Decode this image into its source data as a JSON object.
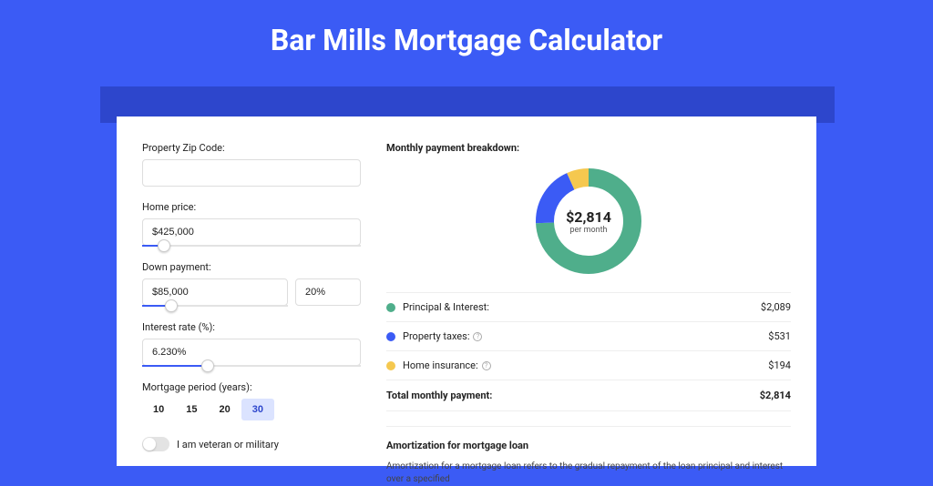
{
  "page_title": "Bar Mills Mortgage Calculator",
  "form": {
    "zip_label": "Property Zip Code:",
    "zip_value": "",
    "home_price_label": "Home price:",
    "home_price_value": "$425,000",
    "home_price_slider_pct": 10,
    "down_label": "Down payment:",
    "down_value": "$85,000",
    "down_pct_value": "20%",
    "down_slider_pct": 20,
    "rate_label": "Interest rate (%):",
    "rate_value": "6.230%",
    "rate_slider_pct": 30,
    "period_label": "Mortgage period (years):",
    "periods": [
      "10",
      "15",
      "20",
      "30"
    ],
    "period_active_index": 3,
    "veteran_label": "I am veteran or military"
  },
  "breakdown": {
    "title": "Monthly payment breakdown:",
    "total_amount": "$2,814",
    "total_sub": "per month",
    "rows": [
      {
        "label": "Principal & Interest:",
        "value": "$2,089",
        "color": "green"
      },
      {
        "label": "Property taxes:",
        "value": "$531",
        "color": "blue",
        "info": true
      },
      {
        "label": "Home insurance:",
        "value": "$194",
        "color": "yellow",
        "info": true
      }
    ],
    "total_label": "Total monthly payment:",
    "total_value": "$2,814"
  },
  "amort": {
    "title": "Amortization for mortgage loan",
    "text": "Amortization for a mortgage loan refers to the gradual repayment of the loan principal and interest over a specified"
  },
  "chart_data": {
    "type": "pie",
    "title": "Monthly payment breakdown",
    "series": [
      {
        "name": "Principal & Interest",
        "value": 2089,
        "color": "#4fae8b"
      },
      {
        "name": "Property taxes",
        "value": 531,
        "color": "#3b5bf5"
      },
      {
        "name": "Home insurance",
        "value": 194,
        "color": "#f5c84f"
      }
    ],
    "total": 2814,
    "center_label": "$2,814 per month"
  }
}
